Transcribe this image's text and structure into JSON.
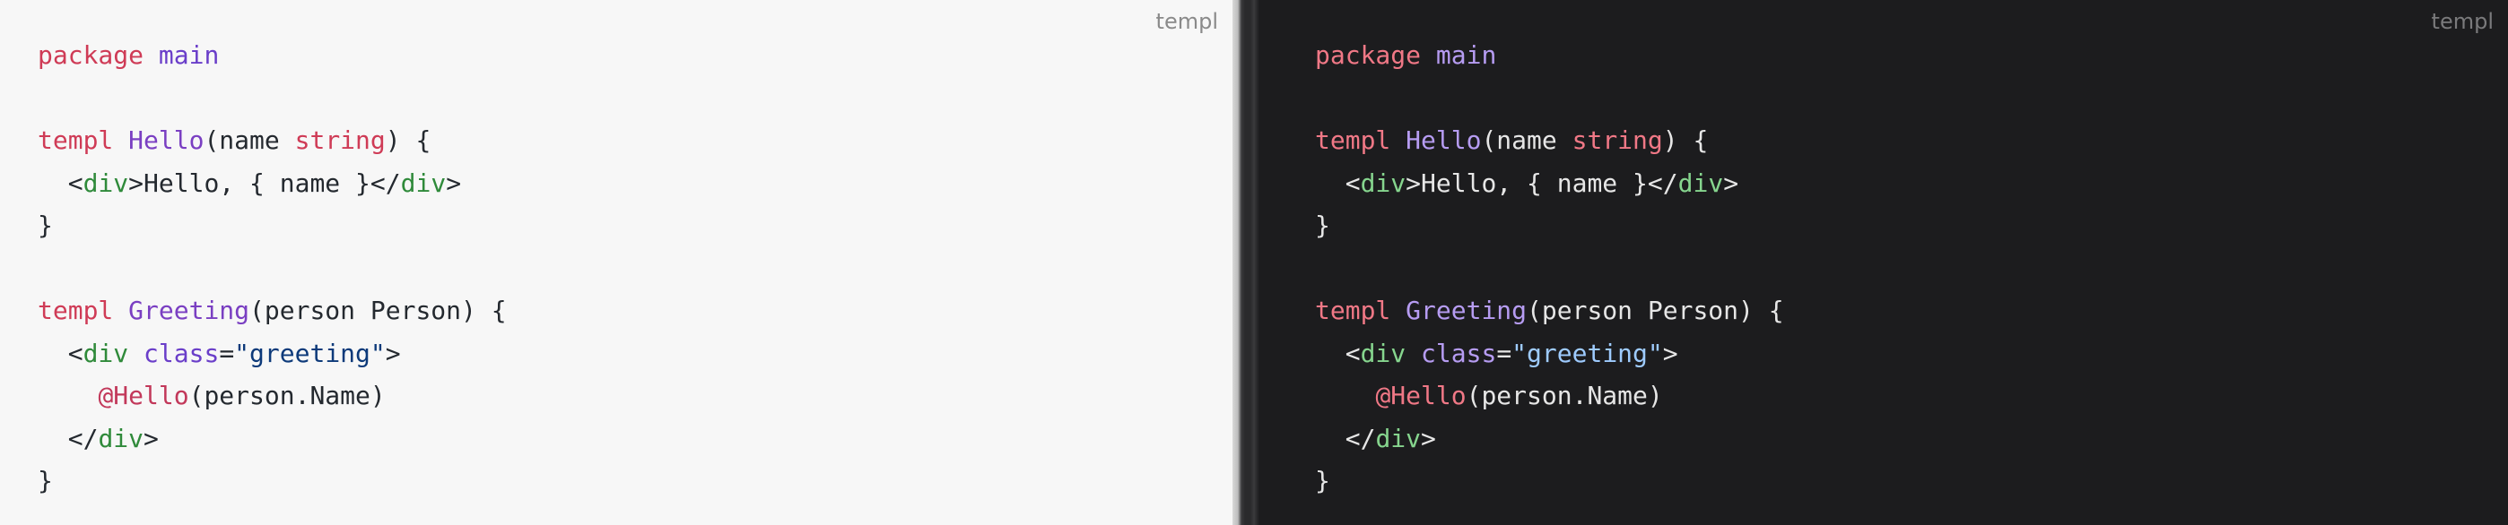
{
  "language_label": "templ",
  "code": {
    "line1": {
      "kw": "package",
      "sp": " ",
      "pkg": "main"
    },
    "line3": {
      "kw": "templ",
      "sp": " ",
      "fn": "Hello",
      "p1": "(name ",
      "typ": "string",
      "p2": ") {"
    },
    "line4": {
      "indent": "  ",
      "lt": "<",
      "tag": "div",
      "gt": ">",
      "text": "Hello, { name }",
      "close_lt": "</",
      "close_tag": "div",
      "close_gt": ">"
    },
    "line5": {
      "brace": "}"
    },
    "line7": {
      "kw": "templ",
      "sp": " ",
      "fn": "Greeting",
      "p1": "(person Person) {"
    },
    "line8": {
      "indent": "  ",
      "lt": "<",
      "tag": "div",
      "sp": " ",
      "attr": "class",
      "eq": "=",
      "str": "\"greeting\"",
      "gt": ">"
    },
    "line9": {
      "indent": "    ",
      "at": "@Hello",
      "args": "(person.Name)"
    },
    "line10": {
      "indent": "  ",
      "close_lt": "</",
      "close_tag": "div",
      "close_gt": ">"
    },
    "line11": {
      "brace": "}"
    }
  }
}
